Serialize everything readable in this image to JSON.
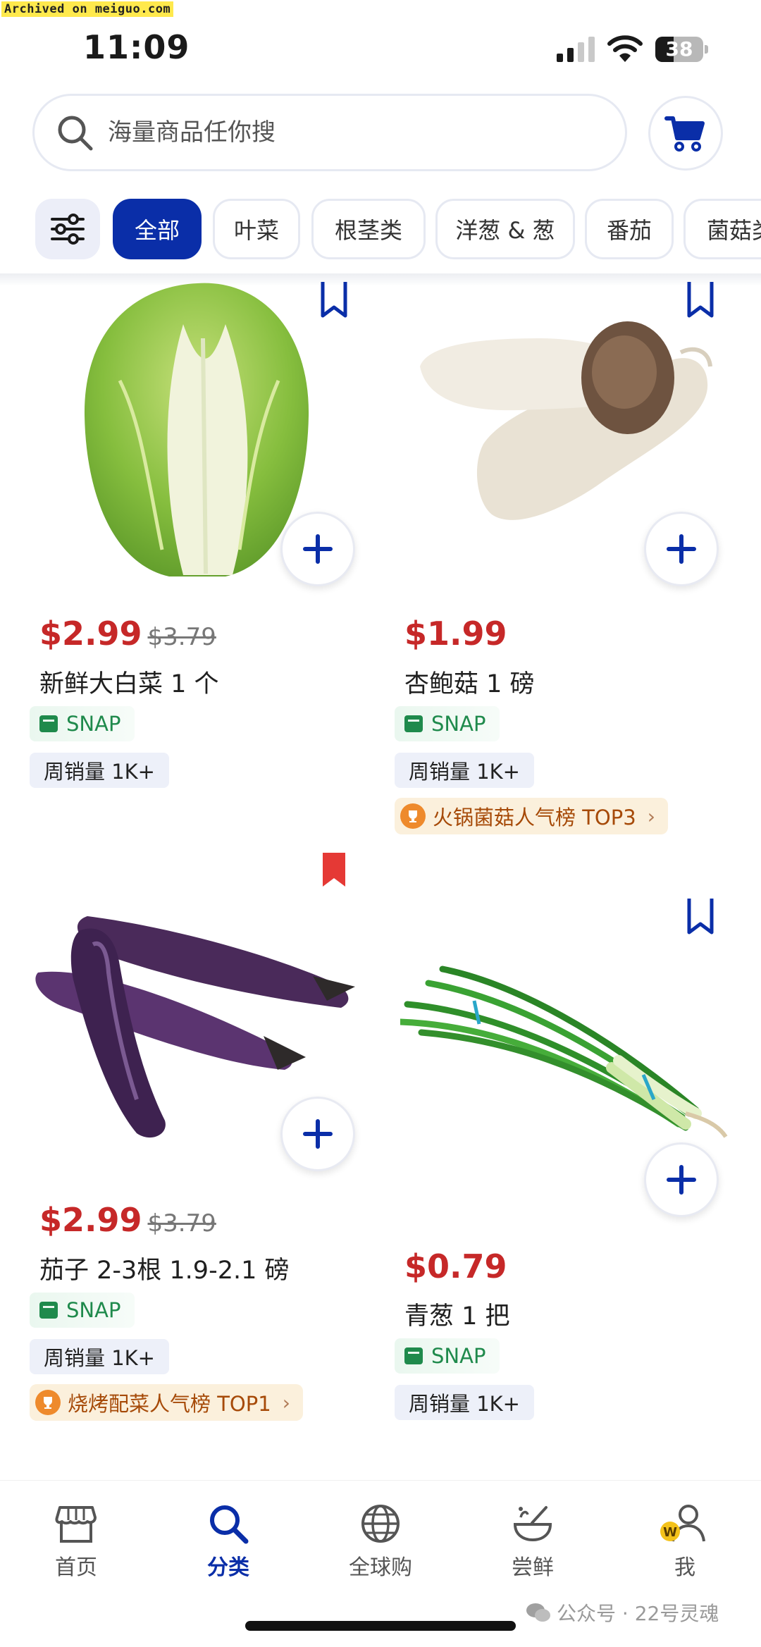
{
  "watermark": "Archived on meiguo.com",
  "status_bar": {
    "time": "11:09",
    "battery_level": "38"
  },
  "search": {
    "placeholder": "海量商品任你搜"
  },
  "filters": {
    "chips": [
      "全部",
      "叶菜",
      "根茎类",
      "洋葱 & 葱",
      "番茄",
      "菌菇类"
    ],
    "active_index": 0
  },
  "products": [
    {
      "price": "$2.99",
      "old_price": "$3.79",
      "name": "新鲜大白菜 1 个",
      "snap": "SNAP",
      "sales": "周销量 1K+",
      "bookmarked": false
    },
    {
      "price": "$1.99",
      "name": "杏鲍菇 1 磅",
      "snap": "SNAP",
      "sales": "周销量 1K+",
      "rank": "火锅菌菇人气榜 TOP3",
      "bookmarked": false
    },
    {
      "price": "$2.99",
      "old_price": "$3.79",
      "name": "茄子 2-3根 1.9-2.1 磅",
      "snap": "SNAP",
      "sales": "周销量 1K+",
      "rank": "烧烤配菜人气榜 TOP1",
      "bookmarked": true
    },
    {
      "price": "$0.79",
      "name": "青葱 1 把",
      "snap": "SNAP",
      "sales": "周销量 1K+",
      "bookmarked": false
    }
  ],
  "bottom_nav": {
    "items": [
      {
        "label": "首页",
        "icon": "store-icon"
      },
      {
        "label": "分类",
        "icon": "search-icon",
        "active": true
      },
      {
        "label": "全球购",
        "icon": "globe-icon"
      },
      {
        "label": "尝鲜",
        "icon": "bowl-icon"
      },
      {
        "label": "我",
        "icon": "user-icon",
        "badge": "W"
      }
    ]
  },
  "footer_watermark": "公众号 · 22号灵魂",
  "colors": {
    "brand_blue": "#0a2ea8",
    "price_red": "#c62828",
    "snap_green": "#1f8a4c",
    "bookmark_red": "#e53935"
  }
}
